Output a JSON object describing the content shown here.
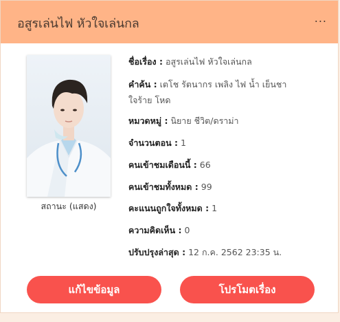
{
  "header": {
    "title": "อสูรเล่นไฟ หัวใจเล่นกล",
    "more": "..."
  },
  "cover": {
    "caption": "สถานะ (แสดง)"
  },
  "info": {
    "title_label": "ชื่อเรื่อง :",
    "title_value": "อสูรเล่นไฟ หัวใจเล่นกล",
    "keywords_label": "คำค้น :",
    "keywords_value_line1": "เตโช รัตนากร เพลิง ไฟ น้ำ เย็นชา",
    "keywords_value_line2": "ใจร้าย โหด",
    "category_label": "หมวดหมู่ :",
    "category_value": "นิยาย ชีวิต/ดราม่า",
    "episodes_label": "จำนวนตอน :",
    "episodes_value": "1",
    "month_views_label": "คนเข้าชมเดือนนี้ :",
    "month_views_value": "66",
    "total_views_label": "คนเข้าชมทั้งหมด :",
    "total_views_value": "99",
    "likes_label": "คะแนนถูกใจทั้งหมด :",
    "likes_value": "1",
    "comments_label": "ความคิดเห็น :",
    "comments_value": "0",
    "updated_label": "ปรับปรุงล่าสุด :",
    "updated_value": "12 ก.ค. 2562 23:35 น."
  },
  "buttons": {
    "edit": "แก้ไขข้อมูล",
    "promote": "โปรโมตเรื่อง"
  },
  "colors": {
    "header_bg": "#ffb487",
    "button_bg": "#f9524d",
    "page_bg": "#fbeee3"
  }
}
